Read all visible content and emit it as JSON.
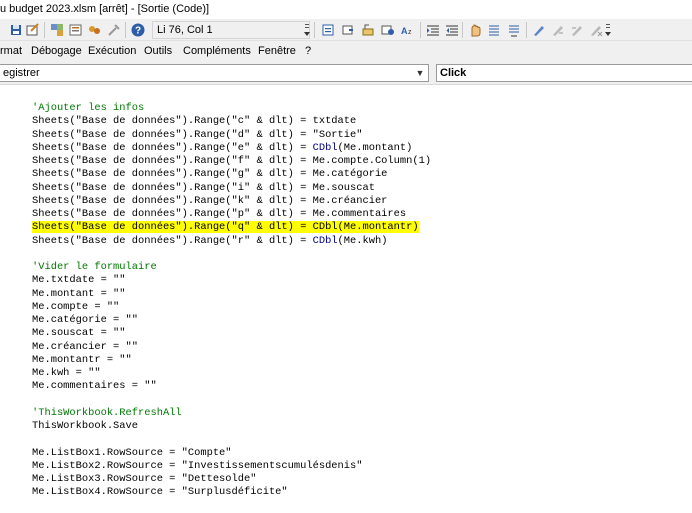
{
  "window": {
    "title": "u budget 2023.xlsm [arrêt] - [Sortie (Code)]"
  },
  "toolbar": {
    "position_label": "Li 76, Col 1",
    "icons": [
      "save-icon",
      "insert-module-icon",
      "vba-project-icon",
      "properties-icon",
      "object-browser-icon",
      "toolbox-icon",
      "help-icon",
      "indent-icon",
      "outdent-icon",
      "toggle-breakpoint-icon",
      "comment-icon",
      "uncomment-icon",
      "quick-info-icon",
      "param-info-icon",
      "complete-word-icon",
      "bookmark-icon",
      "next-bookmark-icon",
      "prev-bookmark-icon",
      "clear-bookmarks-icon"
    ],
    "help_glyph": "?"
  },
  "menu": {
    "items": [
      "rmat",
      "Débogage",
      "Exécution",
      "Outils",
      "Compléments",
      "Fenêtre",
      "?"
    ]
  },
  "selectors": {
    "object": "egistrer",
    "procedure": "Click"
  },
  "code": {
    "lines": [
      {
        "text": "'Ajouter les infos",
        "type": "comment"
      },
      {
        "text": "Sheets(\"Base de données\").Range(\"c\" & dlt) = txtdate",
        "type": "code"
      },
      {
        "text": "Sheets(\"Base de données\").Range(\"d\" & dlt) = \"Sortie\"",
        "type": "code"
      },
      {
        "pre": "Sheets(\"Base de données\").Range(\"e\" & dlt) = ",
        "kw": "CDbl",
        "post": "(Me.montant)",
        "type": "kwcode"
      },
      {
        "text": "Sheets(\"Base de données\").Range(\"f\" & dlt) = Me.compte.Column(1)",
        "type": "code"
      },
      {
        "text": "Sheets(\"Base de données\").Range(\"g\" & dlt) = Me.catégorie",
        "type": "code"
      },
      {
        "text": "Sheets(\"Base de données\").Range(\"i\" & dlt) = Me.souscat",
        "type": "code"
      },
      {
        "text": "Sheets(\"Base de données\").Range(\"k\" & dlt) = Me.créancier",
        "type": "code"
      },
      {
        "text": "Sheets(\"Base de données\").Range(\"p\" & dlt) = Me.commentaires",
        "type": "code"
      },
      {
        "text": "Sheets(\"Base de données\").Range(\"q\" & dlt) = CDbl(Me.montantr)",
        "type": "highlight"
      },
      {
        "pre": "Sheets(\"Base de données\").Range(\"r\" & dlt) = ",
        "kw": "CDbl",
        "post": "(Me.kwh)",
        "type": "kwcode"
      },
      {
        "text": "",
        "type": "blank"
      },
      {
        "text": "'Vider le formulaire",
        "type": "comment"
      },
      {
        "text": "Me.txtdate = \"\"",
        "type": "code"
      },
      {
        "text": "Me.montant = \"\"",
        "type": "code"
      },
      {
        "text": "Me.compte = \"\"",
        "type": "code"
      },
      {
        "text": "Me.catégorie = \"\"",
        "type": "code"
      },
      {
        "text": "Me.souscat = \"\"",
        "type": "code"
      },
      {
        "text": "Me.créancier = \"\"",
        "type": "code"
      },
      {
        "text": "Me.montantr = \"\"",
        "type": "code"
      },
      {
        "text": "Me.kwh = \"\"",
        "type": "code"
      },
      {
        "text": "Me.commentaires = \"\"",
        "type": "code"
      },
      {
        "text": "",
        "type": "blank"
      },
      {
        "text": "'ThisWorkbook.RefreshAll",
        "type": "comment"
      },
      {
        "text": "ThisWorkbook.Save",
        "type": "code"
      },
      {
        "text": "",
        "type": "blank"
      },
      {
        "text": "Me.ListBox1.RowSource = \"Compte\"",
        "type": "code"
      },
      {
        "text": "Me.ListBox2.RowSource = \"Investissementscumulésdenis\"",
        "type": "code"
      },
      {
        "text": "Me.ListBox3.RowSource = \"Dettesolde\"",
        "type": "code"
      },
      {
        "text": "Me.ListBox4.RowSource = \"Surplusdéficite\"",
        "type": "code"
      }
    ]
  },
  "colors": {
    "comment": "#007800",
    "keyword": "#00008b",
    "highlight": "#ffff00"
  }
}
